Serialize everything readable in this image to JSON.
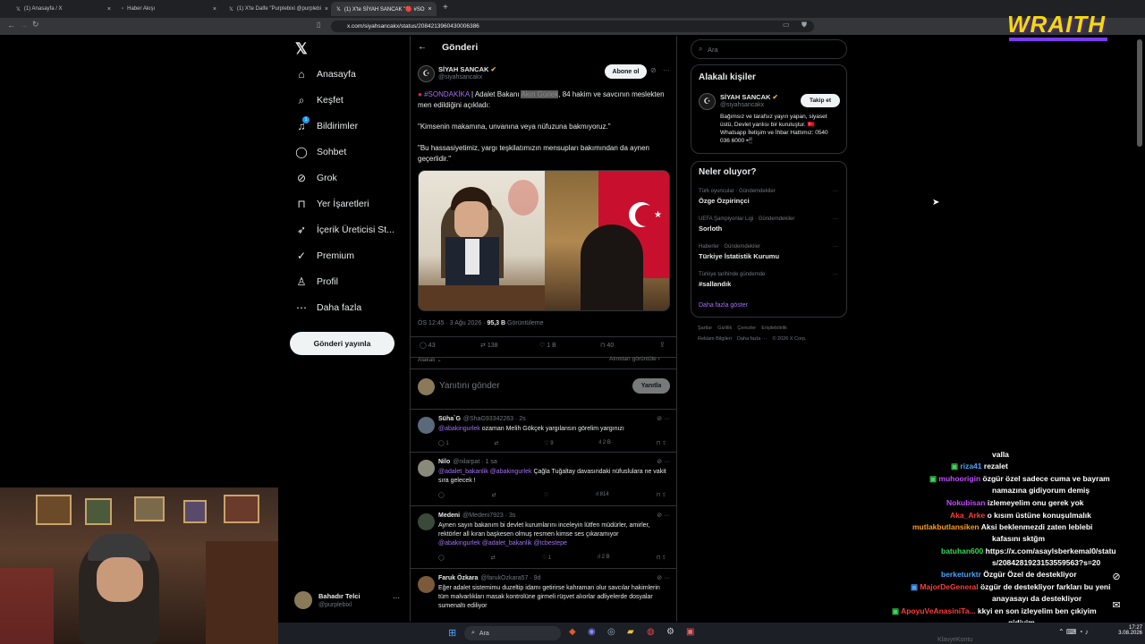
{
  "browser": {
    "tabs": [
      "(1) Anasayfa / X",
      "Haber Akışı",
      "(1) X'te Dalfe \"Purplebixi @purplebi",
      "(1) X'te SİYAH SANCAK \"🔴 #SO"
    ],
    "url": "x.com/siyahsancakx/status/2084213960430006386"
  },
  "nav": {
    "items": [
      "Anasayfa",
      "Keşfet",
      "Bildirimler",
      "Sohbet",
      "Grok",
      "Yer İşaretleri",
      "İçerik Üreticisi St...",
      "Premium",
      "Profil",
      "Daha fazla"
    ],
    "notif_badge": "1",
    "post_button": "Gönderi yayınla",
    "user_name": "Bahadır Telci",
    "user_handle": "@purplebixl"
  },
  "post": {
    "header": "Gönderi",
    "author_name": "SİYAH SANCAK",
    "author_handle": "@siyahsancakx",
    "subscribe_label": "Abone ol",
    "text_tag": "#SONDAKİKA",
    "text_1": " | Adalet Bakanı ",
    "text_hl": "Akın Gürlek",
    "text_2": ", 84 hakim ve savcının meslekten men edildiğini açıkladı:",
    "quote_1": "\"Kimsenin makamına, unvanına veya nüfuzuna bakmıyoruz.\"",
    "quote_2": "\"Bu hassasiyetimiz, yargı teşkilatımızın mensupları bakımından da aynen geçerlidir.\"",
    "time": "ÖS 12:45 · 3 Ağu 2026 · ",
    "views": "95,3 B",
    "views_label": " Görüntüleme",
    "replies": "43",
    "reposts": "138",
    "likes": "1 B",
    "bookmarks": "40",
    "related_label": "Alakalı",
    "quotes_label": "Alıntıları görüntüle",
    "reply_placeholder": "Yanıtını gönder",
    "reply_button": "Yanıtla"
  },
  "replies": [
    {
      "name": "Süha`G",
      "handle": "@ShaG93342263 · 2s",
      "mention": "@abakingurlek",
      "text": " ozaman Melih Gökçek yargılansın görelim yargınızı",
      "r": "",
      "rt": "",
      "l": "9",
      "v": "2 B",
      "rc": "1"
    },
    {
      "name": "Nilo",
      "handle": "@nilarpat · 1 sa",
      "mention": "@adalet_bakanlik @abakingurlek",
      "text": " Çağla Tuğaltay davasındaki nüfuslulara ne vakit sıra gelecek !",
      "r": "",
      "rt": "",
      "l": "",
      "v": "814",
      "rc": ""
    },
    {
      "name": "Medeni",
      "handle": "@Medeni7923 · 3s",
      "mention": "",
      "text": "Aynen sayın bakanım bi devlet kurumlarını inceleyin lütfen müdürler, amirler, rektörler all kıran başkesen olmuş resmen kimse ses çıkaramıyor",
      "mention2": "@abakingurlek @adalet_bakanlik @tcbestepe",
      "r": "",
      "rt": "",
      "l": "1",
      "v": "2 B",
      "rc": ""
    },
    {
      "name": "Faruk Özkara",
      "handle": "@farukOzkara57 · 9d",
      "mention": "",
      "text": "Eğer adalet sistemimu duzeltip idamı getirirse kahraman olur savcılar hakimlerin tüm malvarlıkları masak kontrolüne girmeli rüşvet alıorlar adliyelerde dosyalar sumenaltı ediliyor",
      "r": "",
      "rt": "",
      "l": "",
      "v": "",
      "rc": ""
    }
  ],
  "right": {
    "search_placeholder": "Ara",
    "related_title": "Alakalı kişiler",
    "person_name": "SİYAH SANCAK",
    "person_handle": "@siyahsancakx",
    "follow_label": "Takip et",
    "bio": "Bağımsız ve tarafsız yayın yapan, siyaset üstü, Devlet yanlısı bir kuruluştur. 🇹🇷 Whatsapp İletişim ve İhbar Hattımız: 0540 036 6000 📲",
    "trends_title": "Neler oluyor?",
    "trends": [
      {
        "context": "Türk oyuncular · Gündemdekiler",
        "title": "Özge Özpirinçci"
      },
      {
        "context": "UEFA Şampiyonlar Ligi · Gündemdekiler",
        "title": "Sorloth"
      },
      {
        "context": "Haberler · Gündemdekiler",
        "title": "Türkiye İstatistik Kurumu"
      },
      {
        "context": "Türkiye tarihinde gündemde",
        "title": "#sallandık"
      }
    ],
    "show_more": "Daha fazla göster",
    "footer_1": "Şartlar    Gizlilik    Çerezler    Erişilebilirlik",
    "footer_2": "Reklam Bilgileri    Daha fazla ···    © 2026 X Corp."
  },
  "overlay": {
    "brand": "WRAITH",
    "chat": [
      {
        "user": "",
        "msg": "valla",
        "color": "#ffffff"
      },
      {
        "user": "riza41",
        "msg": "rezalet",
        "color": "#4aa3ff"
      },
      {
        "user": "muhoorigin",
        "msg": "özgür özel sadece cuma ve bayram",
        "color": "#c04bff"
      },
      {
        "user": "",
        "msg": "namazına gidiyorum demiş",
        "color": "#ffffff"
      },
      {
        "user": "Nokubisan",
        "msg": "izlemeyelim onu gerek yok",
        "color": "#c04bff"
      },
      {
        "user": "Aka_Arke",
        "msg": "o kısım üstüne konuşulmalık",
        "color": "#ff3b3b"
      },
      {
        "user": "mutlakbutlansiken",
        "msg": "Aksi beklenmezdi zaten leblebi",
        "color": "#ff9f1a"
      },
      {
        "user": "",
        "msg": "kafasını sktğm",
        "color": "#ffffff"
      },
      {
        "user": "batuhan600",
        "msg": "https://x.com/asaylsberkemal0/statu",
        "color": "#3cd65b"
      },
      {
        "user": "",
        "msg": "s/2084281923153559563?s=20",
        "color": "#ffffff"
      },
      {
        "user": "berketurktr",
        "msg": "Özgür Özel de destekliyor",
        "color": "#4aa3ff"
      },
      {
        "user": "MajorDeGeneral",
        "msg": "özgür de destekliyor farkları bu yeni",
        "color": "#ff3b3b"
      },
      {
        "user": "",
        "msg": "anayasayı da destekliyor",
        "color": "#ffffff"
      },
      {
        "user": "ApoyuVeAnasiniTa...",
        "msg": "kkyi en son izleyelim ben çıkiyim",
        "color": "#ff3b3b"
      },
      {
        "user": "",
        "msg": "gidiyim",
        "color": "#ffffff"
      }
    ],
    "watermark": "KlavyeKontu"
  },
  "taskbar": {
    "search": "Ara",
    "time": "17:27",
    "date": "3.08.2026"
  }
}
